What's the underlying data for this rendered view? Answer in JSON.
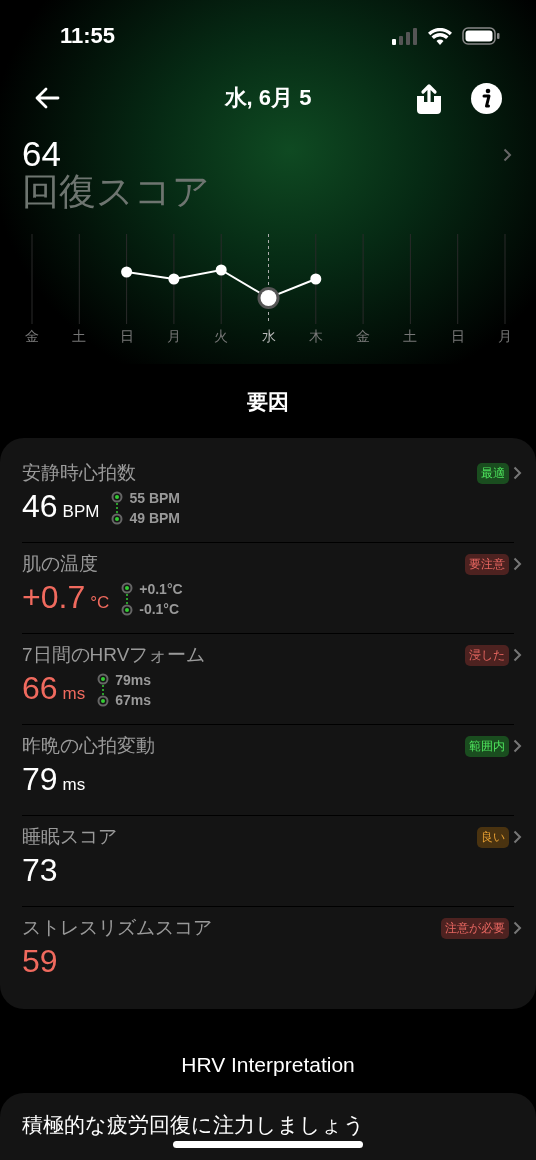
{
  "status_bar": {
    "time": "11:55"
  },
  "header": {
    "title": "水, 6月 5"
  },
  "score": {
    "value": "64",
    "label": "回復スコア"
  },
  "week": [
    {
      "label": "金",
      "selected": false
    },
    {
      "label": "土",
      "selected": false
    },
    {
      "label": "日",
      "selected": false
    },
    {
      "label": "月",
      "selected": false
    },
    {
      "label": "火",
      "selected": false
    },
    {
      "label": "水",
      "selected": true
    },
    {
      "label": "木",
      "selected": false
    },
    {
      "label": "金",
      "selected": false
    },
    {
      "label": "土",
      "selected": false
    },
    {
      "label": "日",
      "selected": false
    },
    {
      "label": "月",
      "selected": false
    }
  ],
  "factors_title": "要因",
  "factors": [
    {
      "name": "安静時心拍数",
      "value": "46",
      "unit": "BPM",
      "alert": false,
      "range": [
        "55 BPM",
        "49 BPM"
      ],
      "badge": "最適",
      "color": "#1a4d1f"
    },
    {
      "name": "肌の温度",
      "value": "+0.7",
      "unit": "°C",
      "alert": true,
      "range": [
        "+0.1°C",
        "-0.1°C"
      ],
      "badge": "要注意",
      "color": "#4d2220"
    },
    {
      "name": "7日間のHRVフォーム",
      "value": "66",
      "unit": "ms",
      "alert": true,
      "range": [
        "79ms",
        "67ms"
      ],
      "badge": "浸した",
      "color": "#4d2220"
    },
    {
      "name": "昨晩の心拍変動",
      "value": "79",
      "unit": "ms",
      "alert": false,
      "badge": "範囲内",
      "color": "#1a4d1f"
    },
    {
      "name": "睡眠スコア",
      "value": "73",
      "alert": false,
      "badge": "良い",
      "color": "#4a3310"
    },
    {
      "name": "ストレスリズムスコア",
      "value": "59",
      "alert": true,
      "badge": "注意が必要",
      "color": "#4d2220"
    }
  ],
  "interpretation": {
    "title": "HRV Interpretation",
    "text": "積極的な疲労回復に注力しましょう"
  }
}
